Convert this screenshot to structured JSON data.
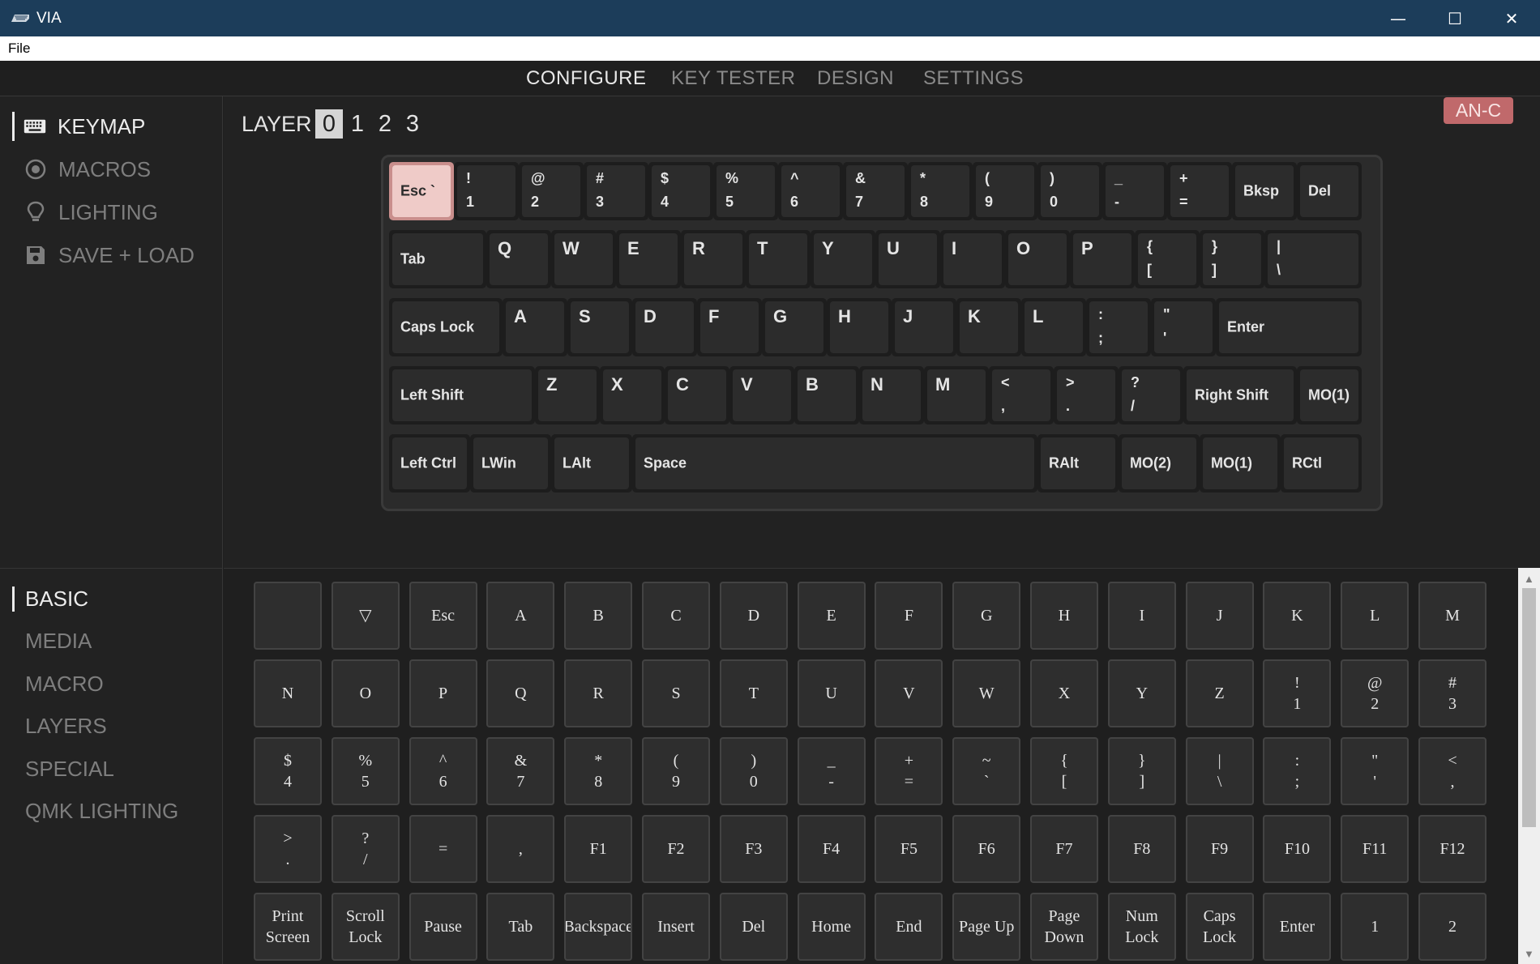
{
  "window": {
    "title": "VIA",
    "minimize": "—",
    "maximize": "☐",
    "close": "✕"
  },
  "menubar": {
    "file": "File"
  },
  "topnav": {
    "configure": "CONFIGURE",
    "key_tester": "KEY TESTER",
    "design": "DESIGN",
    "settings": "SETTINGS",
    "active": "configure"
  },
  "sidebar": {
    "keymap": {
      "label": "KEYMAP",
      "icon": "keyboard-icon"
    },
    "macros": {
      "label": "MACROS",
      "icon": "macro-circle-icon"
    },
    "lighting": {
      "label": "LIGHTING",
      "icon": "lightbulb-icon"
    },
    "save_load": {
      "label": "SAVE + LOAD",
      "icon": "save-icon"
    }
  },
  "layers": {
    "label": "LAYER",
    "items": [
      "0",
      "1",
      "2",
      "3"
    ],
    "selected": "0"
  },
  "badge": "AN-C",
  "keyboard_keys": [
    {
      "label": "Esc `",
      "selected": true
    },
    {
      "shift": "!",
      "base": "1"
    },
    {
      "shift": "@",
      "base": "2"
    },
    {
      "shift": "#",
      "base": "3"
    },
    {
      "shift": "$",
      "base": "4"
    },
    {
      "shift": "%",
      "base": "5"
    },
    {
      "shift": "^",
      "base": "6"
    },
    {
      "shift": "&",
      "base": "7"
    },
    {
      "shift": "*",
      "base": "8"
    },
    {
      "shift": "(",
      "base": "9"
    },
    {
      "shift": ")",
      "base": "0"
    },
    {
      "shift": "_",
      "base": "-"
    },
    {
      "shift": "+",
      "base": "="
    },
    {
      "label": "Bksp"
    },
    {
      "label": "Del"
    },
    {
      "label": "Tab"
    },
    {
      "single": "Q"
    },
    {
      "single": "W"
    },
    {
      "single": "E"
    },
    {
      "single": "R"
    },
    {
      "single": "T"
    },
    {
      "single": "Y"
    },
    {
      "single": "U"
    },
    {
      "single": "I"
    },
    {
      "single": "O"
    },
    {
      "single": "P"
    },
    {
      "shift": "{",
      "base": "["
    },
    {
      "shift": "}",
      "base": "]"
    },
    {
      "shift": "|",
      "base": "\\"
    },
    {
      "label": "Caps Lock"
    },
    {
      "single": "A"
    },
    {
      "single": "S"
    },
    {
      "single": "D"
    },
    {
      "single": "F"
    },
    {
      "single": "G"
    },
    {
      "single": "H"
    },
    {
      "single": "J"
    },
    {
      "single": "K"
    },
    {
      "single": "L"
    },
    {
      "shift": ":",
      "base": ";"
    },
    {
      "shift": "\"",
      "base": "'"
    },
    {
      "label": "Enter"
    },
    {
      "label": "Left Shift"
    },
    {
      "single": "Z"
    },
    {
      "single": "X"
    },
    {
      "single": "C"
    },
    {
      "single": "V"
    },
    {
      "single": "B"
    },
    {
      "single": "N"
    },
    {
      "single": "M"
    },
    {
      "shift": "<",
      "base": ","
    },
    {
      "shift": ">",
      "base": "."
    },
    {
      "shift": "?",
      "base": "/"
    },
    {
      "label": "Right Shift"
    },
    {
      "label": "MO(1)"
    },
    {
      "label": "Left Ctrl"
    },
    {
      "label": "LWin"
    },
    {
      "label": "LAlt"
    },
    {
      "label": "Space"
    },
    {
      "label": "RAlt"
    },
    {
      "label": "MO(2)"
    },
    {
      "label": "MO(1)"
    },
    {
      "label": "RCtl"
    }
  ],
  "categories": {
    "items": [
      "BASIC",
      "MEDIA",
      "MACRO",
      "LAYERS",
      "SPECIAL",
      "QMK LIGHTING"
    ],
    "active": "BASIC"
  },
  "palette_keys": [
    [
      ""
    ],
    [
      "▽"
    ],
    [
      "Esc"
    ],
    [
      "A"
    ],
    [
      "B"
    ],
    [
      "C"
    ],
    [
      "D"
    ],
    [
      "E"
    ],
    [
      "F"
    ],
    [
      "G"
    ],
    [
      "H"
    ],
    [
      "I"
    ],
    [
      "J"
    ],
    [
      "K"
    ],
    [
      "L"
    ],
    [
      "M"
    ],
    [
      "N"
    ],
    [
      "O"
    ],
    [
      "P"
    ],
    [
      "Q"
    ],
    [
      "R"
    ],
    [
      "S"
    ],
    [
      "T"
    ],
    [
      "U"
    ],
    [
      "V"
    ],
    [
      "W"
    ],
    [
      "X"
    ],
    [
      "Y"
    ],
    [
      "Z"
    ],
    [
      "!",
      "1"
    ],
    [
      "@",
      "2"
    ],
    [
      "#",
      "3"
    ],
    [
      "$",
      "4"
    ],
    [
      "%",
      "5"
    ],
    [
      "^",
      "6"
    ],
    [
      "&",
      "7"
    ],
    [
      "*",
      "8"
    ],
    [
      "(",
      "9"
    ],
    [
      ")",
      "0"
    ],
    [
      "_",
      "-"
    ],
    [
      "+",
      "="
    ],
    [
      "~",
      "`"
    ],
    [
      "{",
      "["
    ],
    [
      "}",
      "]"
    ],
    [
      "|",
      "\\"
    ],
    [
      ":",
      ";"
    ],
    [
      "\"",
      "'"
    ],
    [
      "<",
      ","
    ],
    [
      ">",
      "."
    ],
    [
      "?",
      "/"
    ],
    [
      "="
    ],
    [
      ","
    ],
    [
      "F1"
    ],
    [
      "F2"
    ],
    [
      "F3"
    ],
    [
      "F4"
    ],
    [
      "F5"
    ],
    [
      "F6"
    ],
    [
      "F7"
    ],
    [
      "F8"
    ],
    [
      "F9"
    ],
    [
      "F10"
    ],
    [
      "F11"
    ],
    [
      "F12"
    ],
    [
      "Print",
      "Screen"
    ],
    [
      "Scroll",
      "Lock"
    ],
    [
      "Pause"
    ],
    [
      "Tab"
    ],
    [
      "Backspace"
    ],
    [
      "Insert"
    ],
    [
      "Del"
    ],
    [
      "Home"
    ],
    [
      "End"
    ],
    [
      "Page Up"
    ],
    [
      "Page",
      "Down"
    ],
    [
      "Num",
      "Lock"
    ],
    [
      "Caps",
      "Lock"
    ],
    [
      "Enter"
    ],
    [
      "1"
    ],
    [
      "2"
    ]
  ],
  "scrollbar": {
    "up": "▲",
    "down": "▼"
  }
}
